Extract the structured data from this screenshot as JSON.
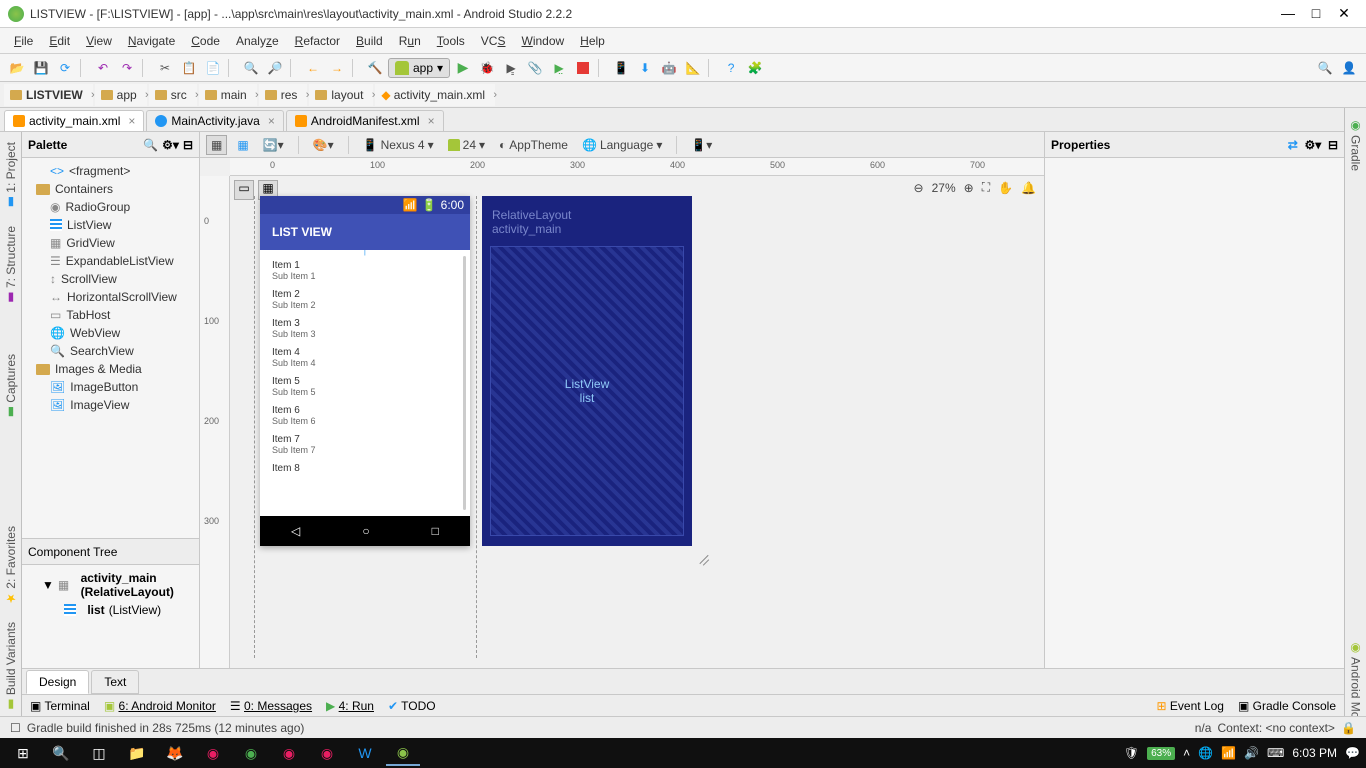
{
  "window": {
    "title": "LISTVIEW - [F:\\LISTVIEW] - [app] - ...\\app\\src\\main\\res\\layout\\activity_main.xml - Android Studio 2.2.2"
  },
  "menu": [
    "File",
    "Edit",
    "View",
    "Navigate",
    "Code",
    "Analyze",
    "Refactor",
    "Build",
    "Run",
    "Tools",
    "VCS",
    "Window",
    "Help"
  ],
  "runconfig": "app",
  "breadcrumb": [
    "LISTVIEW",
    "app",
    "src",
    "main",
    "res",
    "layout",
    "activity_main.xml"
  ],
  "tabs": [
    {
      "label": "activity_main.xml",
      "active": true,
      "kind": "xml"
    },
    {
      "label": "MainActivity.java",
      "active": false,
      "kind": "java"
    },
    {
      "label": "AndroidManifest.xml",
      "active": false,
      "kind": "xml"
    }
  ],
  "leftStrip": [
    "1: Project",
    "7: Structure",
    "Captures",
    "2: Favorites",
    "Build Variants"
  ],
  "rightStrip": [
    "Gradle",
    "Android Model"
  ],
  "palette": {
    "title": "Palette",
    "fragment": "<fragment>",
    "containers": "Containers",
    "items_containers": [
      "RadioGroup",
      "ListView",
      "GridView",
      "ExpandableListView",
      "ScrollView",
      "HorizontalScrollView",
      "TabHost",
      "WebView",
      "SearchView"
    ],
    "images": "Images & Media",
    "items_images": [
      "ImageButton",
      "ImageView"
    ]
  },
  "componentTree": {
    "title": "Component Tree",
    "root": "activity_main (RelativeLayout)",
    "child": "list (ListView)"
  },
  "designToolbar": {
    "device": "Nexus 4",
    "api": "24",
    "theme": "AppTheme",
    "lang": "Language"
  },
  "zoom": "27%",
  "devicePreview": {
    "time": "6:00",
    "appbar": "LIST VIEW",
    "items": [
      {
        "t": "Item 1",
        "s": "Sub Item 1"
      },
      {
        "t": "Item 2",
        "s": "Sub Item 2"
      },
      {
        "t": "Item 3",
        "s": "Sub Item 3"
      },
      {
        "t": "Item 4",
        "s": "Sub Item 4"
      },
      {
        "t": "Item 5",
        "s": "Sub Item 5"
      },
      {
        "t": "Item 6",
        "s": "Sub Item 6"
      },
      {
        "t": "Item 7",
        "s": "Sub Item 7"
      },
      {
        "t": "Item 8",
        "s": ""
      }
    ]
  },
  "blueprint": {
    "root": "RelativeLayout",
    "root_id": "activity_main",
    "child": "ListView",
    "child_id": "list"
  },
  "ruler_h": [
    "0",
    "100",
    "200",
    "300",
    "400",
    "500",
    "600",
    "700"
  ],
  "ruler_v": [
    "0",
    "100",
    "200",
    "300"
  ],
  "properties": "Properties",
  "designText": {
    "design": "Design",
    "text": "Text"
  },
  "bottomTools": {
    "terminal": "Terminal",
    "monitor": "6: Android Monitor",
    "messages": "0: Messages",
    "run": "4: Run",
    "todo": "TODO",
    "eventlog": "Event Log",
    "gradlec": "Gradle Console"
  },
  "status": {
    "msg": "Gradle build finished in 28s 725ms (12 minutes ago)",
    "na": "n/a",
    "ctx": "Context: <no context>"
  },
  "taskbar": {
    "battery": "63%",
    "clock": "6:03 PM"
  }
}
